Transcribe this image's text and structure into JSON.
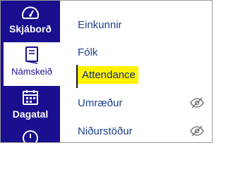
{
  "global_nav": {
    "dashboard": {
      "label": "Skjáborð",
      "icon": "dashboard-icon"
    },
    "course": {
      "label": "Námskeið",
      "icon": "book-icon"
    },
    "calendar": {
      "label": "Dagatal",
      "icon": "calendar-icon"
    },
    "more": {
      "icon": "clock-icon"
    }
  },
  "course_nav": {
    "items": [
      {
        "label": "Einkunnir"
      },
      {
        "label": "Fólk"
      },
      {
        "label": "Attendance",
        "active": true,
        "highlighted": true
      },
      {
        "label": "Umræður",
        "hidden_icon": "eye-slash-icon"
      },
      {
        "label": "Niðurstöður",
        "hidden_icon": "eye-slash-icon"
      }
    ]
  },
  "colors": {
    "global_nav_bg": "#1a0f8f",
    "link": "#1f3f8f",
    "highlight": "#fff200"
  }
}
